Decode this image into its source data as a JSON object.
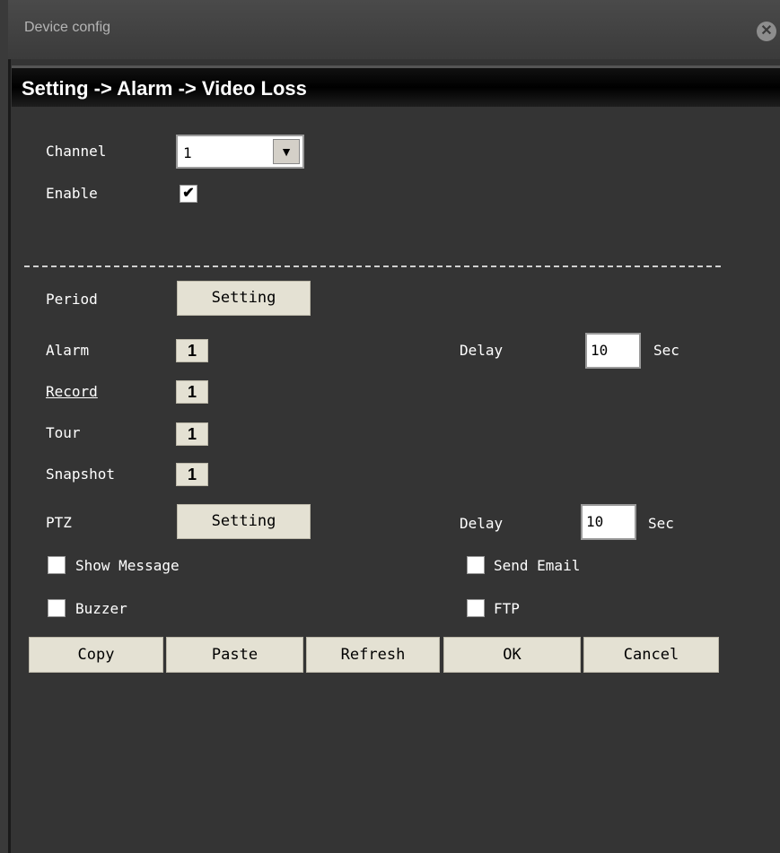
{
  "window": {
    "title": "Device config"
  },
  "breadcrumb": "Setting -> Alarm -> Video Loss",
  "channel": {
    "label": "Channel",
    "value": "1"
  },
  "enable": {
    "label": "Enable",
    "checked": true,
    "mark": "✔"
  },
  "period": {
    "label": "Period",
    "button": "Setting"
  },
  "alarm": {
    "label": "Alarm",
    "value": "1"
  },
  "record": {
    "label": "Record",
    "value": "1"
  },
  "tour": {
    "label": "Tour",
    "value": "1"
  },
  "snapshot": {
    "label": "Snapshot",
    "value": "1"
  },
  "ptz": {
    "label": "PTZ",
    "button": "Setting"
  },
  "alarm_delay": {
    "label": "Delay",
    "value": "10",
    "unit": "Sec"
  },
  "ptz_delay": {
    "label": "Delay",
    "value": "10",
    "unit": "Sec"
  },
  "show_message": {
    "label": "Show Message",
    "checked": false
  },
  "buzzer": {
    "label": "Buzzer",
    "checked": false
  },
  "send_email": {
    "label": "Send Email",
    "checked": false
  },
  "ftp": {
    "label": "FTP",
    "checked": false
  },
  "buttons": {
    "copy": "Copy",
    "paste": "Paste",
    "refresh": "Refresh",
    "ok": "OK",
    "cancel": "Cancel"
  },
  "icons": {
    "close": "close-icon",
    "dropdown": "chevron-down-icon",
    "check": "checkmark-icon"
  },
  "colors": {
    "background": "#343434",
    "button": "#e4e1d3",
    "text": "#ffffff"
  }
}
